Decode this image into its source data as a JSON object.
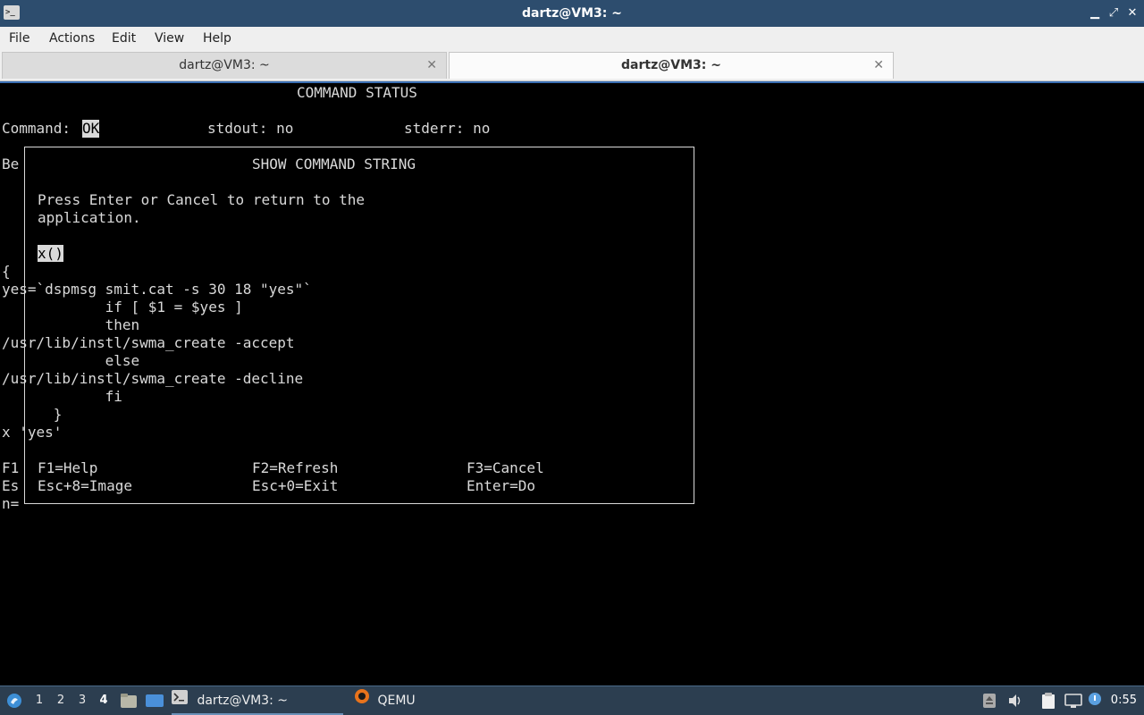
{
  "window": {
    "title": "dartz@VM3: ~",
    "controls": {
      "minimize": "▁",
      "maximize": "⤢",
      "close": "✕"
    }
  },
  "menu": [
    "File",
    "Actions",
    "Edit",
    "View",
    "Help"
  ],
  "tabs": [
    {
      "label": "dartz@VM3: ~",
      "active": false
    },
    {
      "label": "dartz@VM3: ~",
      "active": true
    }
  ],
  "terminal": {
    "header_title": "COMMAND STATUS",
    "status_label": "Command:",
    "status_value": "OK",
    "stdout": "stdout: no",
    "stderr": "stderr: no",
    "behind_lines": [
      "Be",
      "{",
      "F1",
      "Es",
      "n="
    ],
    "dialog": {
      "title": "SHOW COMMAND STRING",
      "instructions_1": "Press Enter or Cancel to return to the",
      "instructions_2": "application.",
      "cmd_prefix": "x",
      "cmd_hl": "()",
      "code_lines": [
        "yes=`dspmsg smit.cat -s 30 18 \"yes\"`",
        "            if [ $1 = $yes ]",
        "            then",
        "/usr/lib/instl/swma_create -accept",
        "            else",
        "/usr/lib/instl/swma_create -decline",
        "            fi",
        "      }",
        "x 'yes'"
      ],
      "keys": {
        "help": "F1=Help",
        "refresh": "F2=Refresh",
        "cancel": "F3=Cancel",
        "image": "Esc+8=Image",
        "exit": "Esc+0=Exit",
        "do": "Enter=Do"
      }
    }
  },
  "taskbar": {
    "workspaces": [
      "1",
      "2",
      "3",
      "4"
    ],
    "active_workspace": "4",
    "tasks": [
      {
        "label": "dartz@VM3: ~",
        "icon": "terminal-icon"
      },
      {
        "label": "QEMU",
        "icon": "qemu-icon"
      }
    ],
    "clock": "0:55"
  },
  "colors": {
    "titlebar": "#2d4d6e",
    "taskbar": "#2c3e50",
    "accent": "#3a6fb3",
    "terminal_fg": "#d9d9d9"
  }
}
